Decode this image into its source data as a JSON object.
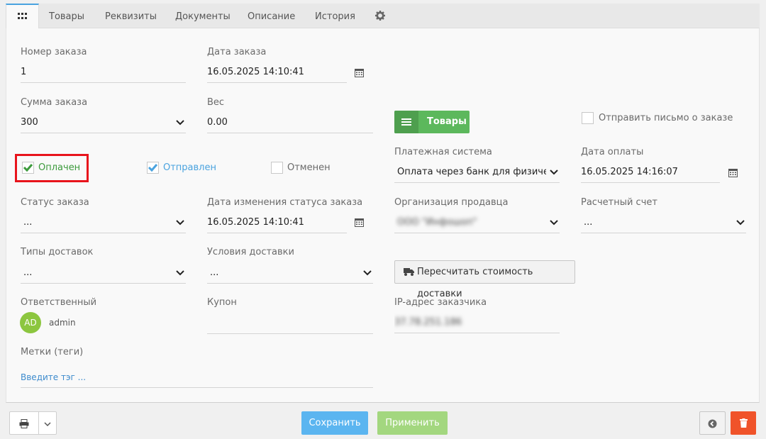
{
  "tabs": [
    {
      "label": "Товары"
    },
    {
      "label": "Реквизиты"
    },
    {
      "label": "Документы"
    },
    {
      "label": "Описание"
    },
    {
      "label": "История"
    }
  ],
  "form": {
    "order_number": {
      "label": "Номер заказа",
      "value": "1"
    },
    "order_date": {
      "label": "Дата заказа",
      "value": "16.05.2025 14:10:41"
    },
    "order_sum": {
      "label": "Сумма заказа",
      "value": "300"
    },
    "weight": {
      "label": "Вес",
      "value": "0.00"
    },
    "goods_button": "Товары",
    "send_email": {
      "label": "Отправить письмо о заказе",
      "checked": false
    },
    "paid": {
      "label": "Оплачен",
      "checked": true
    },
    "shipped": {
      "label": "Отправлен",
      "checked": true
    },
    "cancelled": {
      "label": "Отменен",
      "checked": false
    },
    "payment_system": {
      "label": "Платежная система",
      "value": "Оплата через банк для физических"
    },
    "payment_date": {
      "label": "Дата оплаты",
      "value": "16.05.2025 14:16:07"
    },
    "order_status": {
      "label": "Статус заказа",
      "value": "..."
    },
    "status_change_date": {
      "label": "Дата изменения статуса заказа",
      "value": "16.05.2025 14:10:41"
    },
    "seller_org": {
      "label": "Организация продавца",
      "value": "ООО \"Инфошоп\""
    },
    "account": {
      "label": "Расчетный счет",
      "value": "..."
    },
    "delivery_types": {
      "label": "Типы доставок",
      "value": "..."
    },
    "delivery_terms": {
      "label": "Условия доставки",
      "value": "..."
    },
    "recalc_button": "Пересчитать стоимость доставки",
    "responsible": {
      "label": "Ответственный",
      "avatar": "AD",
      "name": "admin"
    },
    "coupon": {
      "label": "Купон",
      "value": ""
    },
    "ip": {
      "label": "IP-адрес заказчика",
      "value": "37.78.251.186"
    },
    "tags": {
      "label": "Метки (теги)",
      "placeholder": "Введите тэг ..."
    }
  },
  "footer": {
    "save": "Сохранить",
    "apply": "Применить"
  },
  "colors": {
    "accent": "#4aa3df",
    "green": "#5cb85c",
    "save": "#5bb5f0",
    "apply": "#a3d77f",
    "delete": "#f0532a",
    "highlight": "#e8141c"
  },
  "icons": [
    "grid-icon",
    "gear-icon",
    "calendar-icon",
    "chevron-down-icon",
    "list-icon",
    "truck-icon",
    "printer-icon",
    "back-icon",
    "trash-icon"
  ]
}
